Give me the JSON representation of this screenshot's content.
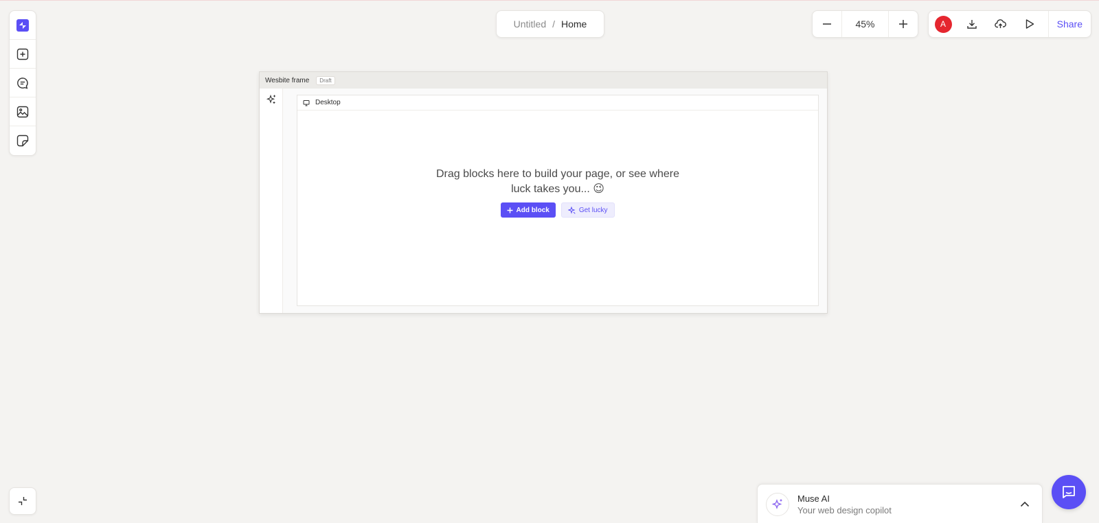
{
  "breadcrumb": {
    "project": "Untitled",
    "separator": "/",
    "page": "Home"
  },
  "zoom": {
    "value": "45%"
  },
  "actions": {
    "avatar_initial": "A",
    "share_label": "Share"
  },
  "frame": {
    "title": "Wesbite frame",
    "badge": "Draft",
    "canvas_label": "Desktop",
    "empty_message": "Drag blocks here to build your page, or see where luck takes you... 😉",
    "add_block_label": "Add block",
    "get_lucky_label": "Get lucky"
  },
  "muse": {
    "title": "Muse AI",
    "subtitle": "Your web design copilot"
  },
  "colors": {
    "accent": "#5b4ff5",
    "avatar": "#e5262f",
    "background": "#f4f3f1"
  },
  "icons": {
    "left_toolbar": [
      "logo-icon",
      "add-square-icon",
      "chat-icon",
      "image-icon",
      "sticker-icon"
    ],
    "collapse": "collapse-icon",
    "actions": [
      "download-icon",
      "cloud-upload-icon",
      "play-icon"
    ]
  }
}
